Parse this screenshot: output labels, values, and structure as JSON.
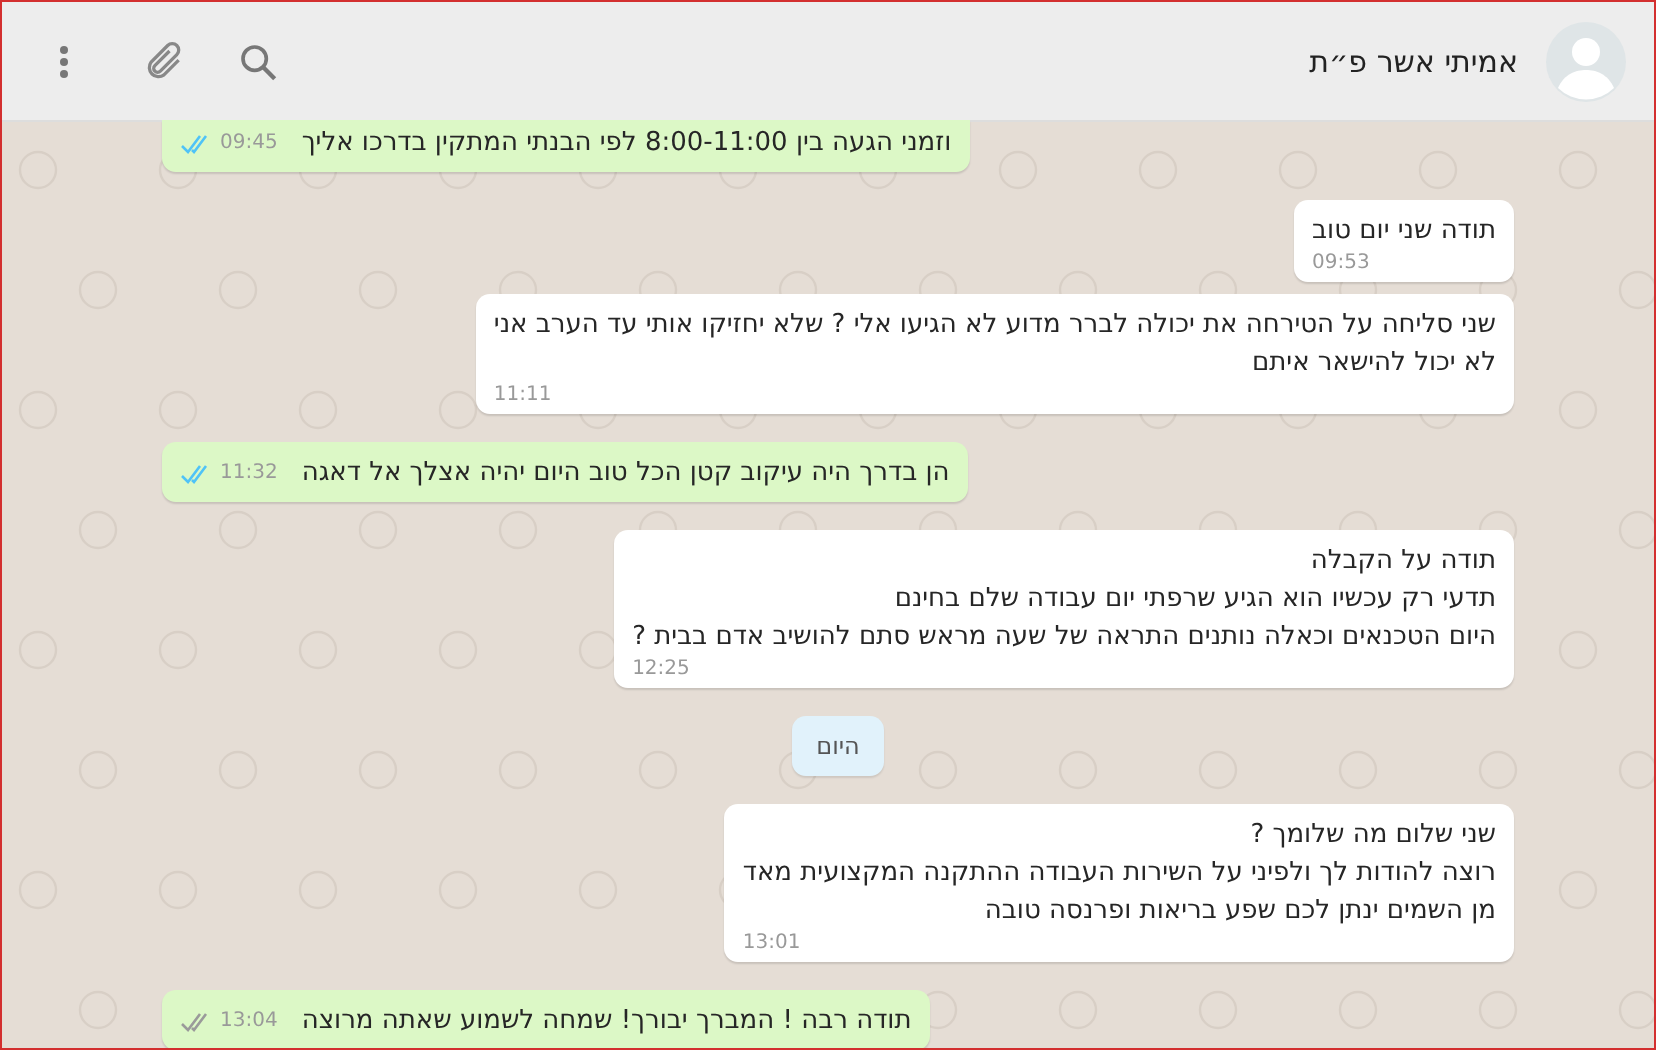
{
  "header": {
    "contact_name": "אמיתי אשר פ״ת"
  },
  "messages": [
    {
      "kind": "outgoing",
      "lines": [
        "וזמני הגעה בין 8:00-11:00 לפי הבנתי המתקין בדרכו אליך"
      ],
      "time": "09:45",
      "read": true
    },
    {
      "kind": "incoming",
      "lines": [
        "תודה שני יום טוב"
      ],
      "time": "09:53"
    },
    {
      "kind": "incoming",
      "lines": [
        "שני סליחה על הטירחה את יכולה לברר מדוע לא הגיעו אלי ? שלא יחזיקו אותי עד הערב אני",
        "לא יכול להישאר איתם"
      ],
      "time": "11:11"
    },
    {
      "kind": "outgoing",
      "lines": [
        "הן בדרך היה עיקוב קטן הכל טוב היום יהיה אצלך אל דאגה"
      ],
      "time": "11:32",
      "read": true
    },
    {
      "kind": "incoming",
      "lines": [
        "תודה על הקבלה",
        "תדעי רק עכשיו הוא הגיע שרפתי יום עבודה שלם בחינם",
        "היום הטכנאים וכאלה נותנים התראה של שעה מראש סתם להושיב אדם בבית ?"
      ],
      "time": "12:25"
    },
    {
      "kind": "date",
      "label": "היום"
    },
    {
      "kind": "incoming",
      "lines": [
        "שני שלום מה שלומך ?",
        "רוצה להודות לך ולפיני על השירות העבודה ההתקנה המקצועית מאד",
        "מן השמים ינתן לכם שפע בריאות ופרנסה טובה"
      ],
      "time": "13:01"
    },
    {
      "kind": "outgoing",
      "lines": [
        "תודה רבה ! המברך יבורך! שמחה לשמוע שאתה מרוצה"
      ],
      "time": "13:04",
      "read": false
    }
  ]
}
